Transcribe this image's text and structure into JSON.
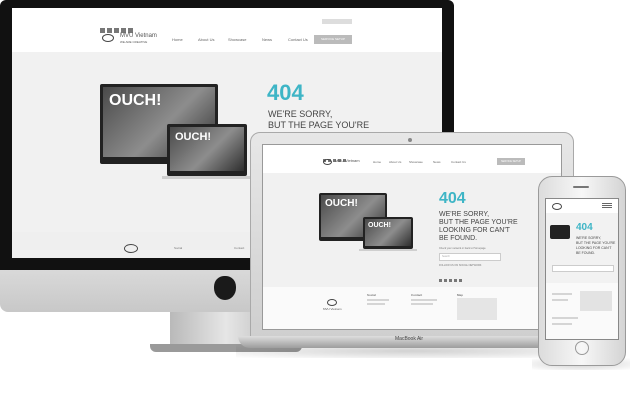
{
  "imac": {
    "nav": [
      "Home",
      "About Us",
      "Showcase",
      "News",
      "Contact Us"
    ],
    "cta_label": "SERVICE SETUP",
    "brand": "MVU Vietnam",
    "brand_sub": "WE ARE CREATIVE",
    "error_code": "404",
    "sorry_line1": "WE'RE SORRY,",
    "sorry_line2": "BUT THE PAGE YOU'RE",
    "ouch_large": "OUCH!",
    "ouch_small": "OUCH!",
    "footer": [
      "Social",
      "Contact"
    ]
  },
  "macbook": {
    "label": "MacBook Air",
    "nav": [
      "Home",
      "About Us",
      "Showcase",
      "News",
      "Contact Us"
    ],
    "cta_label": "SERVICE SETUP",
    "brand": "MVU Vietnam",
    "error_code": "404",
    "sorry_line1": "WE'RE SORRY,",
    "sorry_line2": "BUT THE PAGE YOU'RE",
    "sorry_line3": "LOOKING FOR CAN'T",
    "sorry_line4": "BE FOUND.",
    "help_text": "Check your network or back to Homepage",
    "follow_text": "FOLLOW US ON SOCIAL NETWORK",
    "search_placeholder": "Search",
    "ouch_large": "OUCH!",
    "ouch_small": "OUCH!",
    "footer": [
      "Social",
      "Contact",
      "Map"
    ],
    "footer_brand": "MVU Vietnam"
  },
  "iphone": {
    "error_code": "404",
    "sorry_line1": "WE'RE SORRY,",
    "sorry_line2": "BUT THE PAGE YOU'RE",
    "sorry_line3": "LOOKING FOR CAN'T",
    "sorry_line4": "BE FOUND."
  },
  "colors": {
    "accent": "#3eb5c6"
  }
}
